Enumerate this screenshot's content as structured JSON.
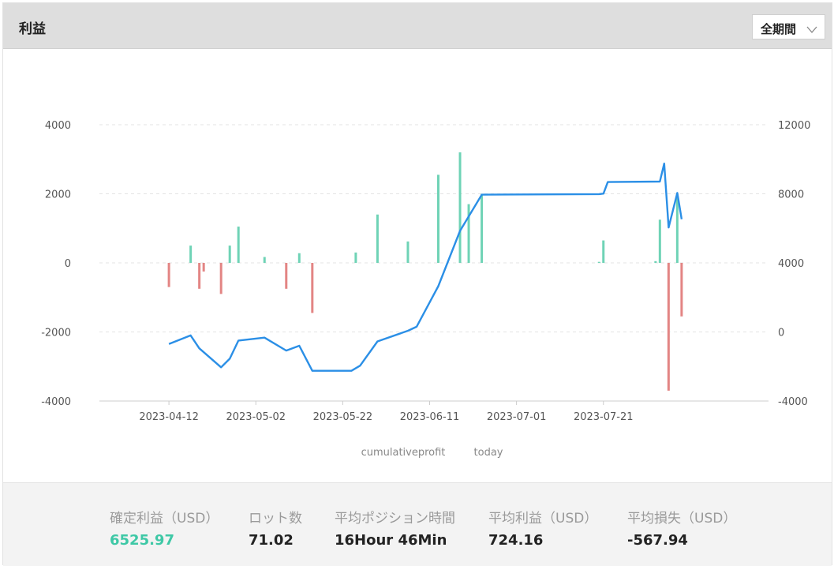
{
  "header": {
    "title": "利益",
    "period_label": "全期間",
    "period_icon": "chevron-down-icon"
  },
  "legend": {
    "line_label": "cumulativeprofit",
    "bar_label": "today"
  },
  "colors": {
    "line": "#2b8fe6",
    "bar_positive": "#6fd3b6",
    "bar_negative": "#e38584",
    "grid": "#e3e3e3",
    "axis_text": "#555555",
    "accent_green": "#3ec8a6"
  },
  "chart_data": {
    "type": "bar",
    "x_type": "date",
    "x_ticks": [
      "2023-04-12",
      "2023-05-02",
      "2023-05-22",
      "2023-06-11",
      "2023-07-01",
      "2023-07-21"
    ],
    "y_left": {
      "ticks": [
        4000,
        2000,
        0,
        -2000,
        -4000
      ],
      "range": [
        -4000,
        4000
      ]
    },
    "y_right": {
      "ticks": [
        12000,
        8000,
        4000,
        0,
        -4000
      ],
      "range": [
        -4000,
        12000
      ]
    },
    "grid": true,
    "legend_position": "bottom-center",
    "series": [
      {
        "name": "today",
        "type": "bar",
        "axis": "left",
        "points": [
          [
            "2023-04-12",
            -700
          ],
          [
            "2023-04-17",
            500
          ],
          [
            "2023-04-19",
            -750
          ],
          [
            "2023-04-20",
            -250
          ],
          [
            "2023-04-24",
            -900
          ],
          [
            "2023-04-26",
            500
          ],
          [
            "2023-04-28",
            1050
          ],
          [
            "2023-05-04",
            170
          ],
          [
            "2023-05-09",
            -750
          ],
          [
            "2023-05-12",
            280
          ],
          [
            "2023-05-15",
            -1450
          ],
          [
            "2023-05-25",
            300
          ],
          [
            "2023-05-30",
            1400
          ],
          [
            "2023-06-06",
            620
          ],
          [
            "2023-06-13",
            2550
          ],
          [
            "2023-06-18",
            3200
          ],
          [
            "2023-06-20",
            1700
          ],
          [
            "2023-06-23",
            2000
          ],
          [
            "2023-07-20",
            30
          ],
          [
            "2023-07-21",
            650
          ],
          [
            "2023-08-02",
            50
          ],
          [
            "2023-08-03",
            1250
          ],
          [
            "2023-08-05",
            -3700
          ],
          [
            "2023-08-07",
            2000
          ],
          [
            "2023-08-08",
            -1550
          ]
        ]
      },
      {
        "name": "cumulativeprofit",
        "type": "line",
        "axis": "right",
        "points": [
          [
            "2023-04-12",
            -700
          ],
          [
            "2023-04-17",
            -200
          ],
          [
            "2023-04-19",
            -950
          ],
          [
            "2023-04-24",
            -2050
          ],
          [
            "2023-04-26",
            -1550
          ],
          [
            "2023-04-28",
            -500
          ],
          [
            "2023-05-04",
            -330
          ],
          [
            "2023-05-09",
            -1080
          ],
          [
            "2023-05-12",
            -800
          ],
          [
            "2023-05-15",
            -2250
          ],
          [
            "2023-05-24",
            -2250
          ],
          [
            "2023-05-26",
            -1950
          ],
          [
            "2023-05-30",
            -550
          ],
          [
            "2023-06-06",
            70
          ],
          [
            "2023-06-08",
            300
          ],
          [
            "2023-06-13",
            2650
          ],
          [
            "2023-06-18",
            5850
          ],
          [
            "2023-06-23",
            7950
          ],
          [
            "2023-07-20",
            7980
          ],
          [
            "2023-07-21",
            8010
          ],
          [
            "2023-07-22",
            8680
          ],
          [
            "2023-08-03",
            8710
          ],
          [
            "2023-08-04",
            9750
          ],
          [
            "2023-08-05",
            6050
          ],
          [
            "2023-08-07",
            8050
          ],
          [
            "2023-08-08",
            6530
          ]
        ]
      }
    ]
  },
  "stats": [
    {
      "label": "確定利益（USD）",
      "value": "6525.97"
    },
    {
      "label": "ロット数",
      "value": "71.02"
    },
    {
      "label": "平均ポジション時間",
      "value": "16Hour 46Min"
    },
    {
      "label": "平均利益（USD）",
      "value": "724.16"
    },
    {
      "label": "平均損失（USD）",
      "value": "-567.94"
    }
  ]
}
